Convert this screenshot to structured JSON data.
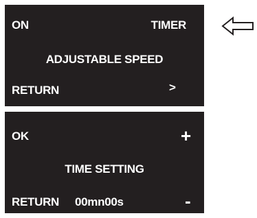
{
  "main_menu": {
    "on_label": "ON",
    "timer_label": "TIMER",
    "title": "ADJUSTABLE SPEED",
    "return_label": "RETURN",
    "next_label": ">"
  },
  "time_menu": {
    "ok_label": "OK",
    "plus_label": "+",
    "title": "TIME SETTING",
    "return_label": "RETURN",
    "time_value": "00mn00s",
    "minus_label": "-"
  },
  "indicator": {
    "icon": "left-arrow-icon",
    "color": "#231f20"
  },
  "colors": {
    "screen_bg": "#231f20",
    "screen_text": "#ffffff",
    "page_bg": "#ffffff"
  }
}
